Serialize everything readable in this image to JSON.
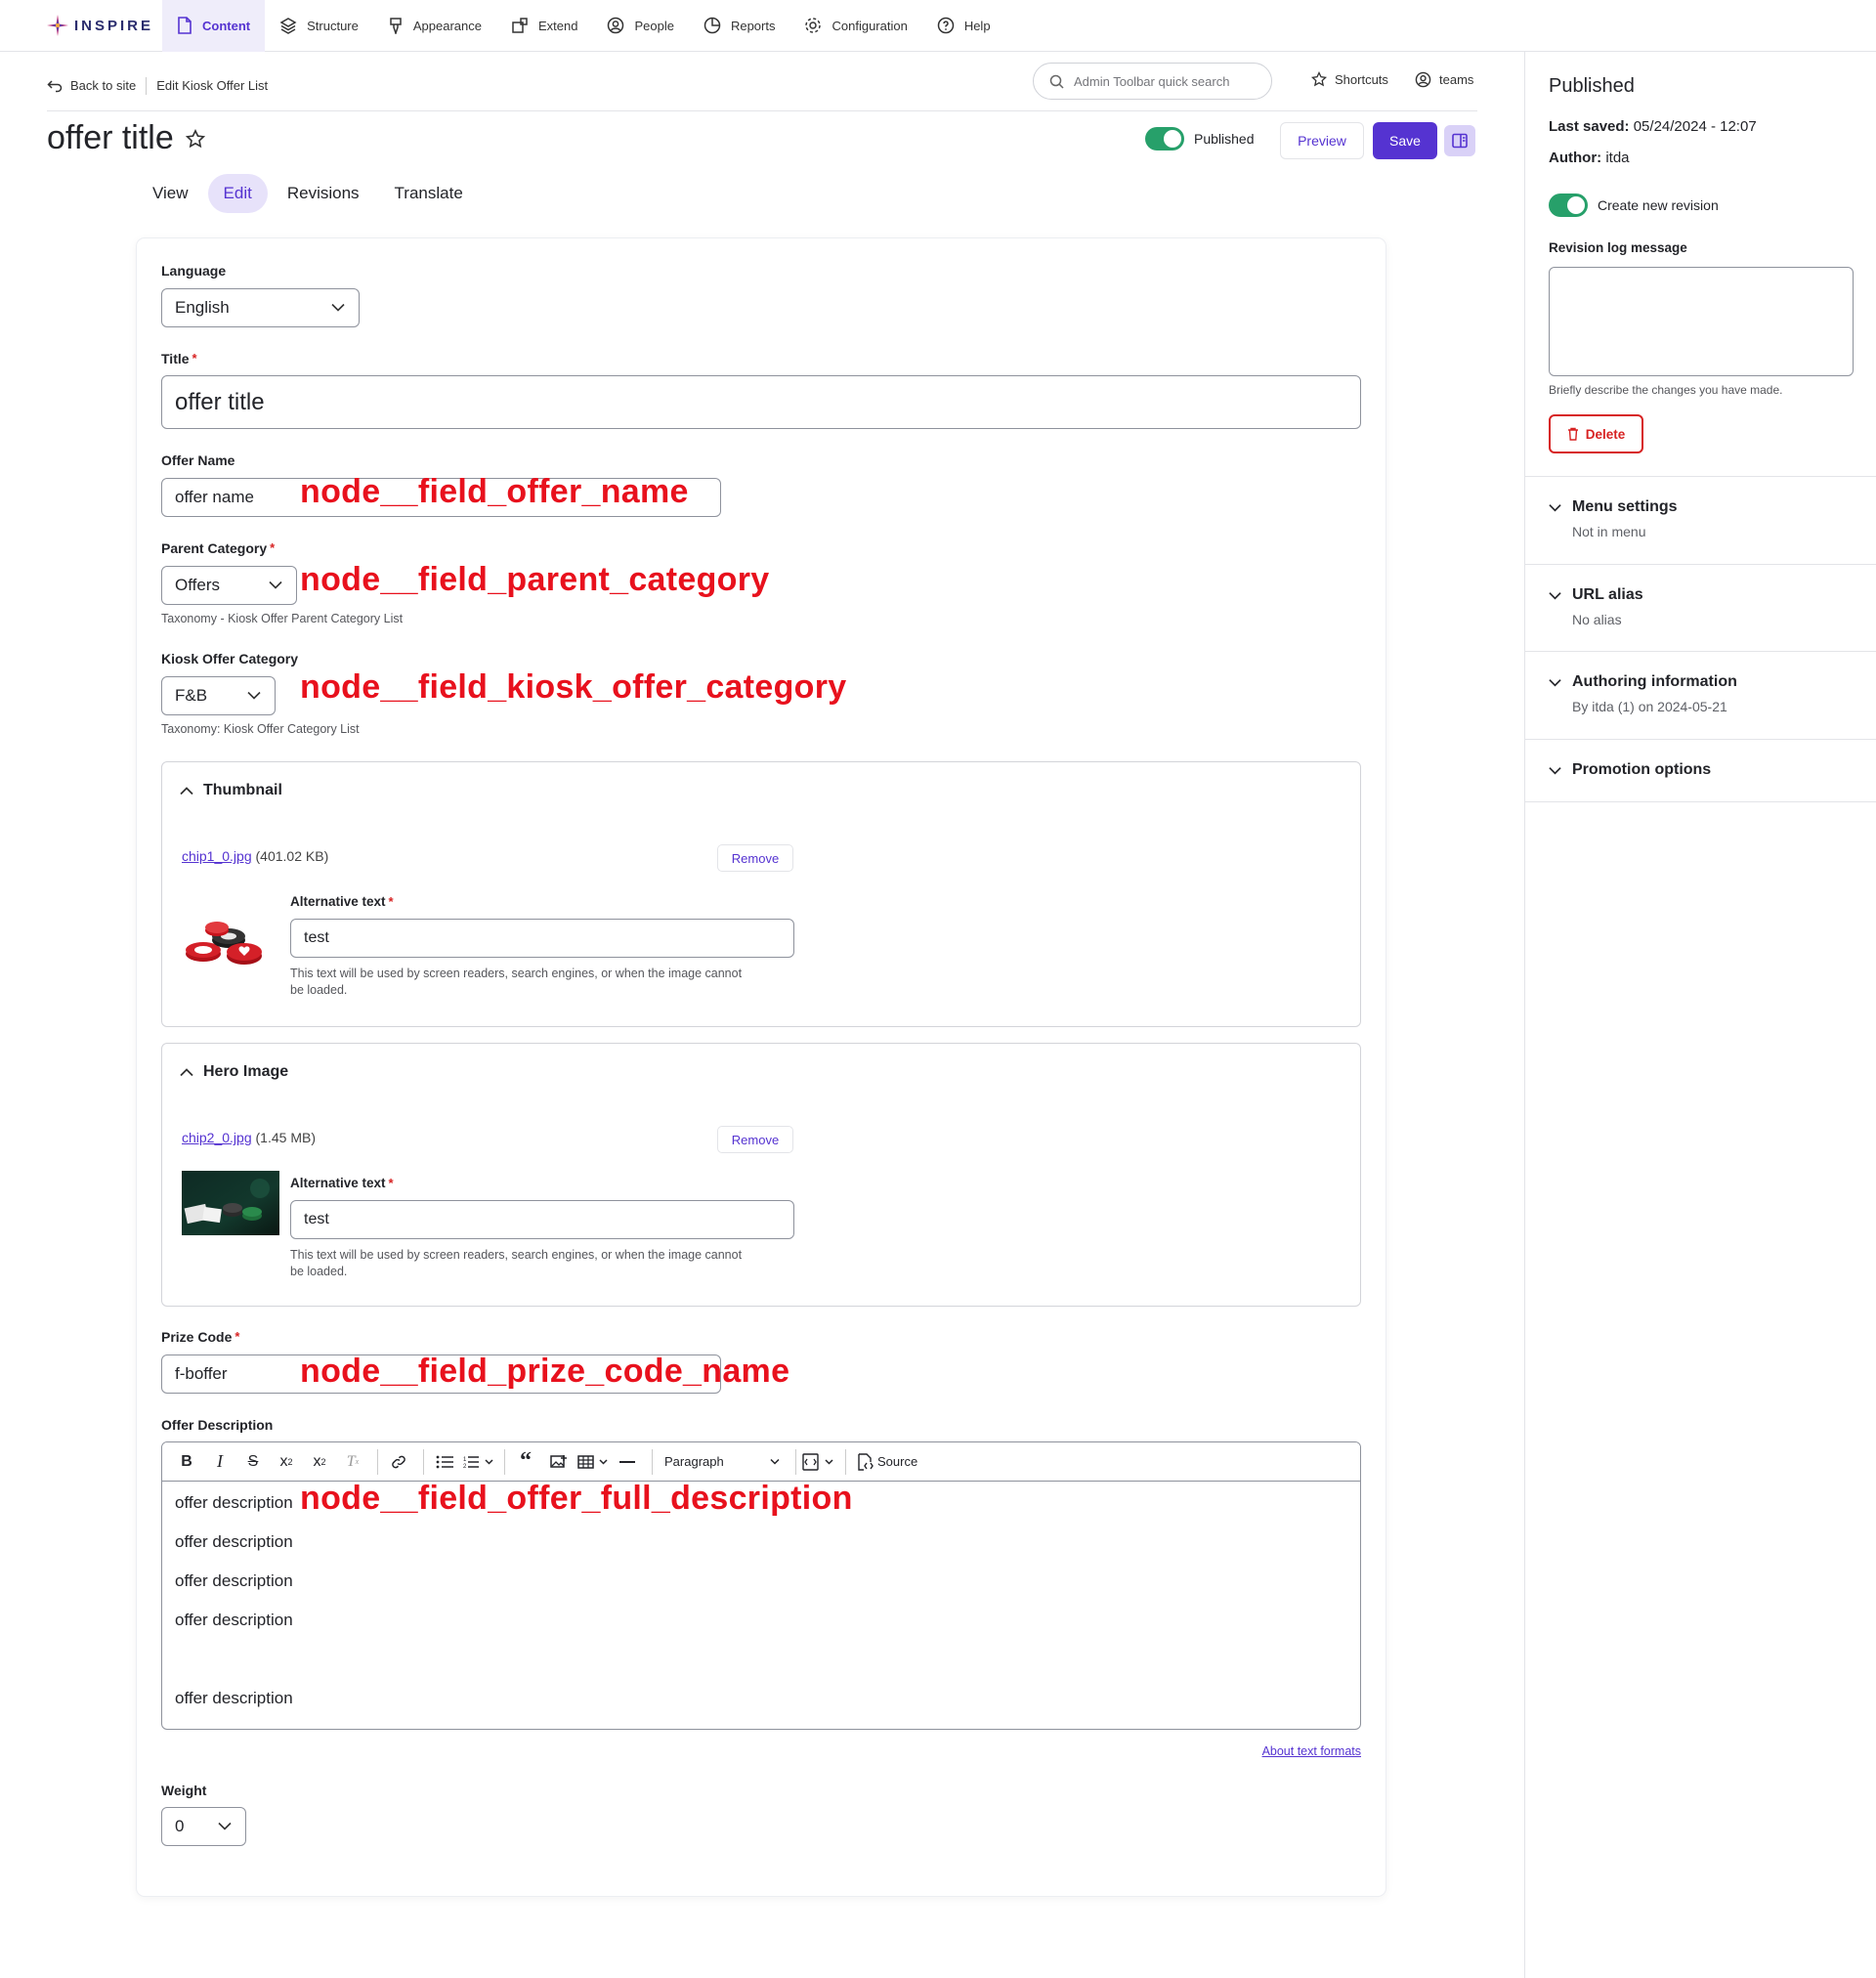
{
  "toolbar": {
    "logo_text": "INSPIRE",
    "items": [
      {
        "label": "Content",
        "icon": "file-icon",
        "active": true
      },
      {
        "label": "Structure",
        "icon": "layers-icon"
      },
      {
        "label": "Appearance",
        "icon": "brush-icon"
      },
      {
        "label": "Extend",
        "icon": "puzzle-icon"
      },
      {
        "label": "People",
        "icon": "user-icon"
      },
      {
        "label": "Reports",
        "icon": "chart-icon"
      },
      {
        "label": "Configuration",
        "icon": "gear-icon"
      },
      {
        "label": "Help",
        "icon": "help-icon"
      }
    ]
  },
  "header": {
    "back_label": "Back to site",
    "crumb_label": "Edit Kiosk Offer List",
    "search_placeholder": "Admin Toolbar quick search",
    "shortcuts_label": "Shortcuts",
    "user_label": "teams",
    "page_title": "offer title",
    "published_label": "Published",
    "preview_label": "Preview",
    "save_label": "Save"
  },
  "tabs": [
    "View",
    "Edit",
    "Revisions",
    "Translate"
  ],
  "form": {
    "language": {
      "label": "Language",
      "value": "English"
    },
    "title": {
      "label": "Title",
      "value": "offer title"
    },
    "offer_name": {
      "label": "Offer Name",
      "value": "offer name",
      "annotation": "node__field_offer_name"
    },
    "parent_category": {
      "label": "Parent Category",
      "value": "Offers",
      "description": "Taxonomy - Kiosk Offer Parent Category List",
      "annotation": "node__field_parent_category"
    },
    "kiosk_category": {
      "label": "Kiosk Offer Category",
      "value": "F&B",
      "description": "Taxonomy: Kiosk Offer Category List",
      "annotation": "node__field_kiosk_offer_category"
    },
    "thumbnail": {
      "legend": "Thumbnail",
      "file_name": "chip1_0.jpg",
      "file_size": "(401.02 KB)",
      "remove_label": "Remove",
      "alt_label": "Alternative text",
      "alt_value": "test",
      "alt_description_line1": "This text will be used by screen readers, search engines, or when the image cannot",
      "alt_description_line2": "be loaded."
    },
    "hero": {
      "legend": "Hero Image",
      "file_name": "chip2_0.jpg",
      "file_size": "(1.45 MB)",
      "remove_label": "Remove",
      "alt_label": "Alternative text",
      "alt_value": "test",
      "alt_description_line1": "This text will be used by screen readers, search engines, or when the image cannot",
      "alt_description_line2": "be loaded."
    },
    "prize_code": {
      "label": "Prize Code",
      "value": "f-boffer",
      "annotation": "node__field_prize_code_name"
    },
    "description": {
      "label": "Offer Description",
      "paragraph_format": "Paragraph",
      "source_label": "Source",
      "lines": [
        "offer description",
        "offer description",
        "offer description",
        "offer description",
        "offer description"
      ],
      "annotation": "node__field_offer_full_description",
      "about_formats": "About text formats"
    },
    "weight": {
      "label": "Weight",
      "value": "0"
    }
  },
  "sidebar": {
    "status_title": "Published",
    "last_saved_label": "Last saved:",
    "last_saved_value": "05/24/2024 - 12:07",
    "author_label": "Author:",
    "author_value": "itda",
    "new_revision_label": "Create new revision",
    "revision_log_label": "Revision log message",
    "revision_log_value": "",
    "revision_log_description": "Briefly describe the changes you have made.",
    "delete_label": "Delete",
    "sections": [
      {
        "title": "Menu settings",
        "summary": "Not in menu"
      },
      {
        "title": "URL alias",
        "summary": "No alias"
      },
      {
        "title": "Authoring information",
        "summary": "By itda (1) on 2024-05-21"
      },
      {
        "title": "Promotion options",
        "summary": ""
      }
    ]
  },
  "colors": {
    "accent": "#5533d1",
    "toggle_on": "#27a06a",
    "annotation_red": "#e8111d",
    "danger": "#d72222"
  }
}
